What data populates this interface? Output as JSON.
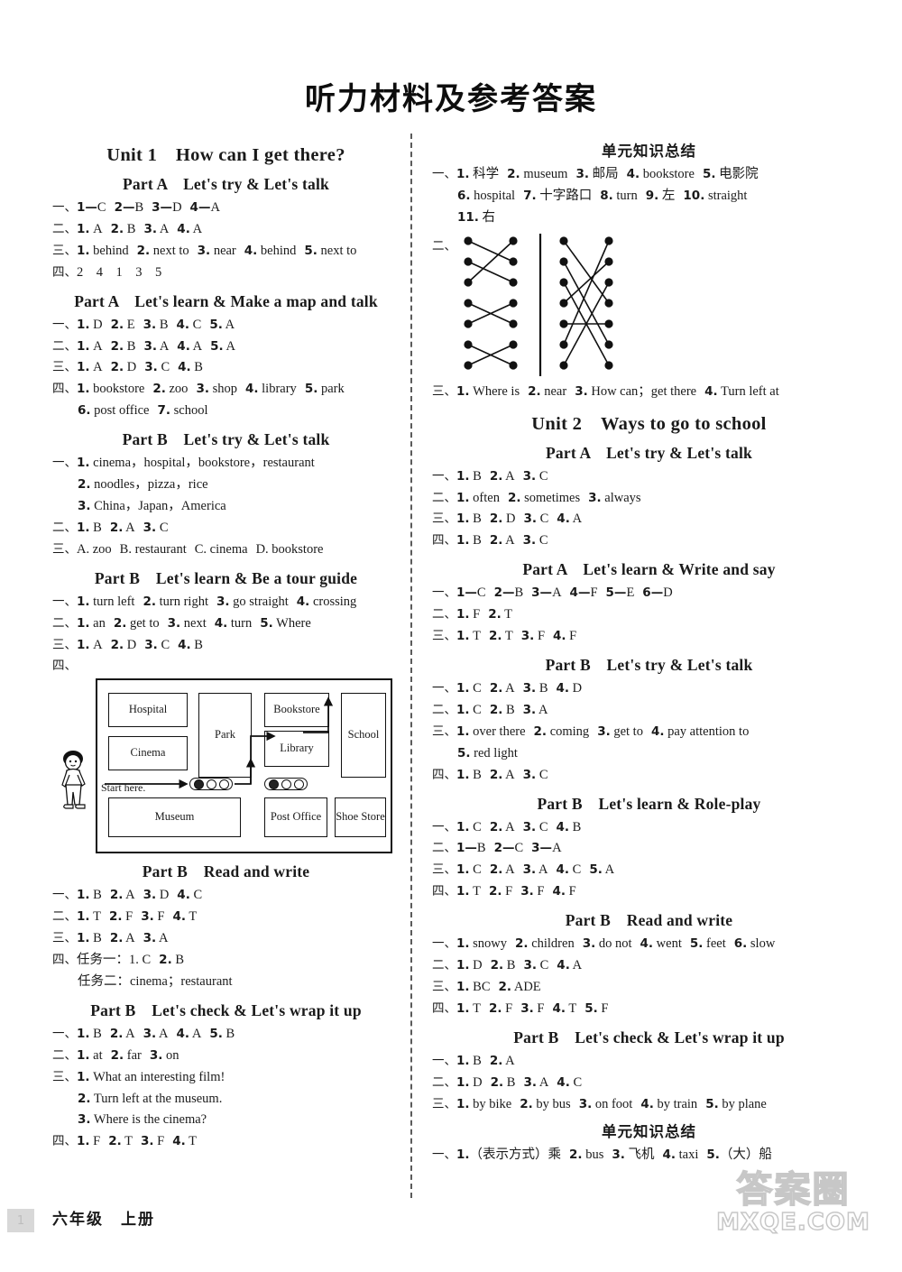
{
  "document": {
    "title": "听力材料及参考答案",
    "footer_grade": "六年级　上册",
    "page_number": "1",
    "watermark_cn": "答案圈",
    "watermark_en": "MXQE.COM"
  },
  "left_column": {
    "unit_heading": "Unit 1　How can I get there?",
    "sections": [
      {
        "part": "Part A　Let's try & Let's talk",
        "lines": [
          {
            "marker": "一、",
            "items": [
              "1—C",
              "2—B",
              "3—D",
              "4—A"
            ]
          },
          {
            "marker": "二、",
            "items": [
              "1. A",
              "2. B",
              "3. A",
              "4. A"
            ]
          },
          {
            "marker": "三、",
            "items": [
              "1. behind",
              "2. next to",
              "3. near",
              "4. behind",
              "5. next to"
            ]
          },
          {
            "marker": "四、",
            "items": [
              "2　4　1　3　5"
            ]
          }
        ]
      },
      {
        "part": "Part A　Let's learn & Make a map and talk",
        "lines": [
          {
            "marker": "一、",
            "items": [
              "1. D",
              "2. E",
              "3. B",
              "4. C",
              "5. A"
            ]
          },
          {
            "marker": "二、",
            "items": [
              "1. A",
              "2. B",
              "3. A",
              "4. A",
              "5. A"
            ]
          },
          {
            "marker": "三、",
            "items": [
              "1. A",
              "2. D",
              "3. C",
              "4. B"
            ]
          },
          {
            "marker": "四、",
            "items": [
              "1. bookstore",
              "2. zoo",
              "3. shop",
              "4. library",
              "5. park"
            ]
          },
          {
            "marker": "",
            "indent": true,
            "items": [
              "6. post office",
              "7. school"
            ]
          }
        ]
      },
      {
        "part": "Part B　Let's try & Let's talk",
        "lines": [
          {
            "marker": "一、",
            "items": [
              "1. cinema，hospital，bookstore，restaurant"
            ]
          },
          {
            "marker": "",
            "indent": true,
            "items": [
              "2. noodles，pizza，rice"
            ]
          },
          {
            "marker": "",
            "indent": true,
            "items": [
              "3. China，Japan，America"
            ]
          },
          {
            "marker": "二、",
            "items": [
              "1. B",
              "2. A",
              "3. C"
            ]
          },
          {
            "marker": "三、",
            "items": [
              "A. zoo",
              "B. restaurant",
              "C. cinema",
              "D. bookstore"
            ]
          }
        ]
      },
      {
        "part": "Part B　Let's learn & Be a tour guide",
        "lines": [
          {
            "marker": "一、",
            "items": [
              "1. turn left",
              "2. turn right",
              "3. go straight",
              "4. crossing"
            ]
          },
          {
            "marker": "二、",
            "items": [
              "1. an",
              "2. get to",
              "3. next",
              "4. turn",
              "5. Where"
            ]
          },
          {
            "marker": "三、",
            "items": [
              "1. A",
              "2. D",
              "3. C",
              "4. B"
            ]
          },
          {
            "marker": "四、",
            "items": [
              ""
            ]
          }
        ]
      },
      {
        "part": "Part B　Read and write",
        "lines": [
          {
            "marker": "一、",
            "items": [
              "1. B",
              "2. A",
              "3. D",
              "4. C"
            ]
          },
          {
            "marker": "二、",
            "items": [
              "1. T",
              "2. F",
              "3. F",
              "4. T"
            ]
          },
          {
            "marker": "三、",
            "items": [
              "1. B",
              "2. A",
              "3. A"
            ]
          },
          {
            "marker": "四、",
            "items": [
              "任务一：1. C",
              "2. B"
            ]
          },
          {
            "marker": "",
            "indent": true,
            "items": [
              "任务二：cinema；restaurant"
            ]
          }
        ]
      },
      {
        "part": "Part B　Let's check & Let's wrap it up",
        "lines": [
          {
            "marker": "一、",
            "items": [
              "1. B",
              "2. A",
              "3. A",
              "4. A",
              "5. B"
            ]
          },
          {
            "marker": "二、",
            "items": [
              "1. at",
              "2. far",
              "3. on"
            ]
          },
          {
            "marker": "三、",
            "items": [
              "1. What an interesting film!"
            ]
          },
          {
            "marker": "",
            "indent": true,
            "items": [
              "2. Turn left at the museum."
            ]
          },
          {
            "marker": "",
            "indent": true,
            "items": [
              "3. Where is the cinema?"
            ]
          },
          {
            "marker": "四、",
            "items": [
              "1. F",
              "2. T",
              "3. F",
              "4. T"
            ]
          }
        ]
      }
    ],
    "map_figure": {
      "caption_marker": "四、",
      "start_label": "Start here.",
      "buildings": [
        {
          "name": "Hospital"
        },
        {
          "name": "Cinema"
        },
        {
          "name": "Park"
        },
        {
          "name": "Bookstore"
        },
        {
          "name": "Library"
        },
        {
          "name": "School"
        },
        {
          "name": "Museum"
        },
        {
          "name": "Post Office"
        },
        {
          "name": "Shoe Store"
        }
      ]
    }
  },
  "right_column": {
    "blocks": [
      {
        "kind": "zh-heading",
        "text": "单元知识总结"
      },
      {
        "kind": "lines",
        "lines": [
          {
            "marker": "一、",
            "items": [
              "1. 科学",
              "2. museum",
              "3. 邮局",
              "4. bookstore",
              "5. 电影院"
            ]
          },
          {
            "marker": "",
            "indent": true,
            "items": [
              "6. hospital",
              "7. 十字路口",
              "8. turn",
              "9. 左",
              "10. straight"
            ]
          },
          {
            "marker": "",
            "indent": true,
            "items": [
              "11. 右"
            ]
          }
        ]
      },
      {
        "kind": "match-figure",
        "marker": "二、"
      },
      {
        "kind": "lines",
        "lines": [
          {
            "marker": "三、",
            "items": [
              "1. Where is",
              "2. near",
              "3. How can；get there",
              "4. Turn left at"
            ]
          }
        ]
      },
      {
        "kind": "unit-heading",
        "text": "Unit 2　Ways to go to school"
      },
      {
        "kind": "part-heading",
        "text": "Part A　Let's try & Let's talk"
      },
      {
        "kind": "lines",
        "lines": [
          {
            "marker": "一、",
            "items": [
              "1. B",
              "2. A",
              "3. C"
            ]
          },
          {
            "marker": "二、",
            "items": [
              "1. often",
              "2. sometimes",
              "3. always"
            ]
          },
          {
            "marker": "三、",
            "items": [
              "1. B",
              "2. D",
              "3. C",
              "4. A"
            ]
          },
          {
            "marker": "四、",
            "items": [
              "1. B",
              "2. A",
              "3. C"
            ]
          }
        ]
      },
      {
        "kind": "part-heading",
        "text": "Part A　Let's learn & Write and say"
      },
      {
        "kind": "lines",
        "lines": [
          {
            "marker": "一、",
            "items": [
              "1—C",
              "2—B",
              "3—A",
              "4—F",
              "5—E",
              "6—D"
            ]
          },
          {
            "marker": "二、",
            "items": [
              "1. F",
              "2. T"
            ]
          },
          {
            "marker": "三、",
            "items": [
              "1. T",
              "2. T",
              "3. F",
              "4. F"
            ]
          }
        ]
      },
      {
        "kind": "part-heading",
        "text": "Part B　Let's try & Let's talk"
      },
      {
        "kind": "lines",
        "lines": [
          {
            "marker": "一、",
            "items": [
              "1. C",
              "2. A",
              "3. B",
              "4. D"
            ]
          },
          {
            "marker": "二、",
            "items": [
              "1. C",
              "2. B",
              "3. A"
            ]
          },
          {
            "marker": "三、",
            "items": [
              "1. over there",
              "2. coming",
              "3. get to",
              "4. pay attention to"
            ]
          },
          {
            "marker": "",
            "indent": true,
            "items": [
              "5. red light"
            ]
          },
          {
            "marker": "四、",
            "items": [
              "1. B",
              "2. A",
              "3. C"
            ]
          }
        ]
      },
      {
        "kind": "part-heading",
        "text": "Part B　Let's learn & Role-play"
      },
      {
        "kind": "lines",
        "lines": [
          {
            "marker": "一、",
            "items": [
              "1. C",
              "2. A",
              "3. C",
              "4. B"
            ]
          },
          {
            "marker": "二、",
            "items": [
              "1—B",
              "2—C",
              "3—A"
            ]
          },
          {
            "marker": "三、",
            "items": [
              "1. C",
              "2. A",
              "3. A",
              "4. C",
              "5. A"
            ]
          },
          {
            "marker": "四、",
            "items": [
              "1. T",
              "2. F",
              "3. F",
              "4. F"
            ]
          }
        ]
      },
      {
        "kind": "part-heading",
        "text": "Part B　Read and write"
      },
      {
        "kind": "lines",
        "lines": [
          {
            "marker": "一、",
            "items": [
              "1. snowy",
              "2. children",
              "3. do not",
              "4. went",
              "5. feet",
              "6. slow"
            ]
          },
          {
            "marker": "二、",
            "items": [
              "1. D",
              "2. B",
              "3. C",
              "4. A"
            ]
          },
          {
            "marker": "三、",
            "items": [
              "1. BC",
              "2. ADE"
            ]
          },
          {
            "marker": "四、",
            "items": [
              "1. T",
              "2. F",
              "3. F",
              "4. T",
              "5. F"
            ]
          }
        ]
      },
      {
        "kind": "part-heading",
        "text": "Part B　Let's check & Let's wrap it up"
      },
      {
        "kind": "lines",
        "lines": [
          {
            "marker": "一、",
            "items": [
              "1. B",
              "2. A"
            ]
          },
          {
            "marker": "二、",
            "items": [
              "1. D",
              "2. B",
              "3. A",
              "4. C"
            ]
          },
          {
            "marker": "三、",
            "items": [
              "1. by bike",
              "2. by bus",
              "3. on foot",
              "4. by train",
              "5. by plane"
            ]
          }
        ]
      },
      {
        "kind": "zh-heading",
        "text": "单元知识总结"
      },
      {
        "kind": "lines",
        "lines": [
          {
            "marker": "一、",
            "items": [
              "1.（表示方式）乘",
              "2. bus",
              "3. 飞机",
              "4. taxi",
              "5.（大）船"
            ]
          }
        ]
      }
    ]
  }
}
